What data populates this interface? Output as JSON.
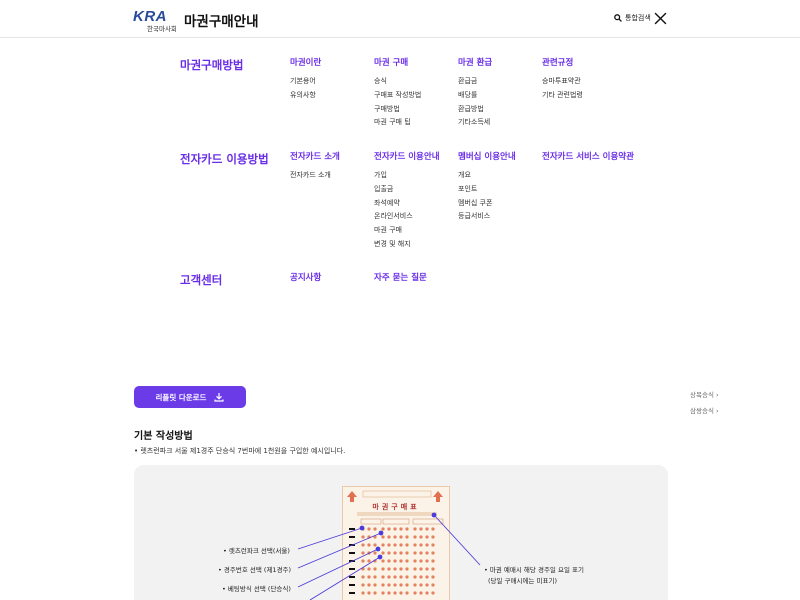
{
  "header": {
    "logo_text": "KRA",
    "logo_sub": "한국마사회",
    "title": "마권구매안내",
    "search_label": "통합검색"
  },
  "sections": [
    {
      "title": "마권구매방법",
      "columns": [
        {
          "head": "마권이란",
          "items": [
            "기본용어",
            "유의사항"
          ]
        },
        {
          "head": "마권 구매",
          "items": [
            "승식",
            "구매표 작성방법",
            "구매방법",
            "마권 구매 팁"
          ]
        },
        {
          "head": "마권 환급",
          "items": [
            "환급금",
            "배당률",
            "환급방법",
            "기타소득세"
          ]
        },
        {
          "head": "관련규정",
          "items": [
            "승마투표약관",
            "기타 관련법령"
          ]
        }
      ]
    },
    {
      "title": "전자카드 이용방법",
      "columns": [
        {
          "head": "전자카드 소개",
          "items": [
            "전자카드 소개"
          ]
        },
        {
          "head": "전자카드 이용안내",
          "items": [
            "가입",
            "입출금",
            "좌석예약",
            "온라인서비스",
            "마권 구매",
            "변경 및 해지"
          ]
        },
        {
          "head": "멤버십 이용안내",
          "items": [
            "개요",
            "포인트",
            "멤버십 쿠폰",
            "등급서비스"
          ]
        },
        {
          "head": "전자카드 서비스 이용약관",
          "items": []
        }
      ]
    },
    {
      "title": "고객센터",
      "columns": [
        {
          "head": "공지사항",
          "items": []
        },
        {
          "head": "자주 묻는 질문",
          "items": []
        }
      ]
    }
  ],
  "download": {
    "label": "리플릿 다운로드"
  },
  "side_links": [
    "상복승식",
    "삼쌍승식"
  ],
  "basic": {
    "title": "기본 작성방법",
    "desc": "• 렛츠런파크 서울 제1경주 단승식 7번마에 1천원을 구입한 예시입니다."
  },
  "ticket": {
    "title": "마권구매표"
  },
  "annotations": {
    "a1": "• 렛츠런파크 선택(서울)",
    "a2": "• 경주번호 선택 (제1경주)",
    "a3": "• 베팅방식 선택 (단승식)",
    "r1": "• 마권 예매시 해당 경주일 요일 표기",
    "r2": "(당일 구매시에는 미표기)"
  },
  "colors": {
    "accent": "#6a2ee8",
    "button": "#6b3be8",
    "logo": "#2a4a9a"
  }
}
